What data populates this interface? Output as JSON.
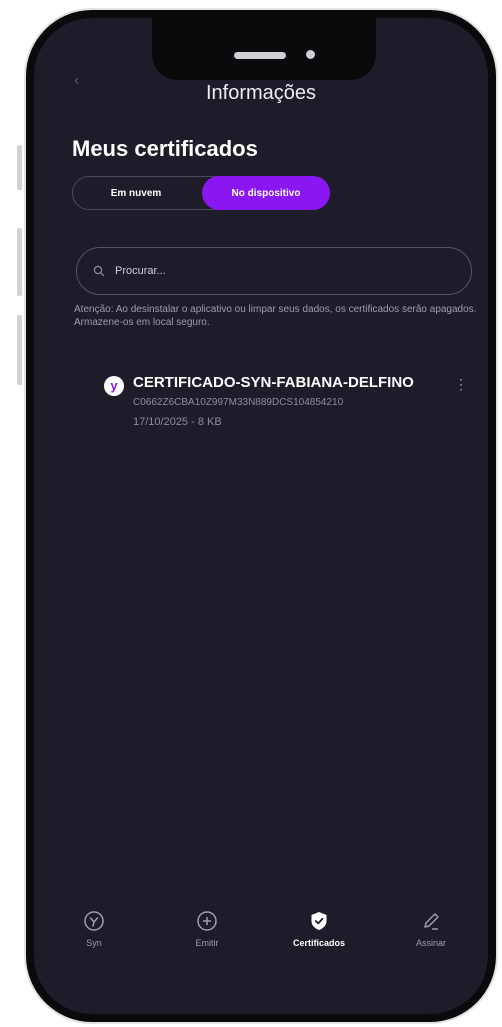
{
  "header": {
    "title": "Informações",
    "back_icon": "chevron-left-icon"
  },
  "page": {
    "title": "Meus certificados"
  },
  "tabs": [
    {
      "label": "Em nuvem",
      "active": false
    },
    {
      "label": "No dispositivo",
      "active": true
    }
  ],
  "search": {
    "placeholder": "Procurar..."
  },
  "notice": "Atenção: Ao desinstalar o aplicativo ou limpar seus dados, os certificados serão apagados. Armazene-os em local seguro.",
  "certificates": [
    {
      "name": "CERTIFICADO-SYN-FABIANA-DELFINO",
      "serial": "C0662Z6CBA10Z997M33N889DCS104854210",
      "meta": "17/10/2025 - 8 KB"
    }
  ],
  "nav": [
    {
      "label": "Syn",
      "icon": "syn-logo-icon",
      "active": false
    },
    {
      "label": "Emitir",
      "icon": "plus-circle-icon",
      "active": false
    },
    {
      "label": "Certificados",
      "icon": "shield-check-icon",
      "active": true
    },
    {
      "label": "Assinar",
      "icon": "pen-icon",
      "active": false
    }
  ],
  "colors": {
    "background": "#1d1c28",
    "accent": "#8a16f2",
    "text": "#ffffff",
    "muted": "#9e9db0"
  }
}
